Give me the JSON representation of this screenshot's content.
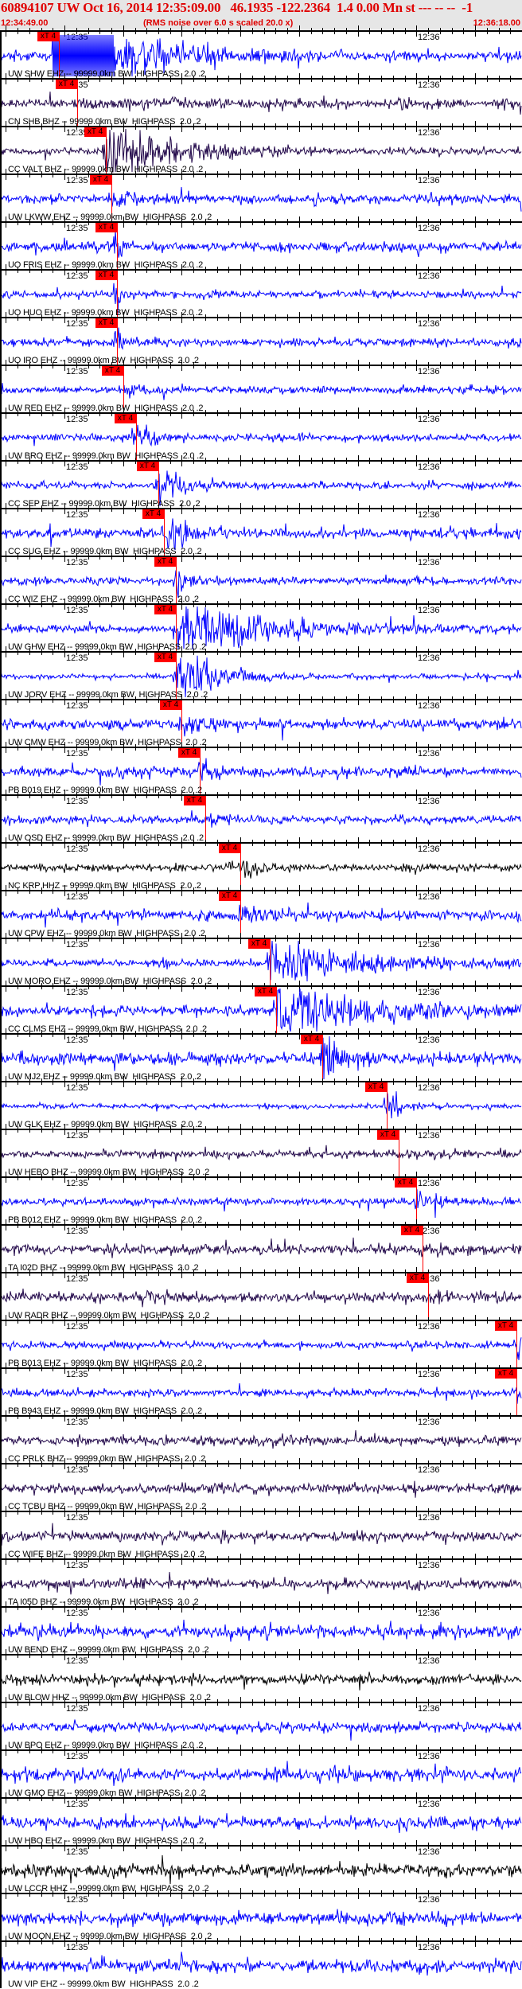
{
  "header": {
    "title": "60894107 UW Oct 16, 2014 12:35:09.00   46.1935 -122.2364  1.4 0.00 Mn st --- -- --  -1",
    "start_time": "12:34:49.00",
    "subtitle": "(RMS noise over 6.0 s scaled 20.0 x)",
    "end_time": "12:36:18.00"
  },
  "axis": {
    "tick_label_1": "12:35",
    "tick_label_2": "12:36",
    "window_seconds": 89,
    "tick_1_seconds": 11,
    "tick_2_seconds": 71
  },
  "pick_label": "xT 4",
  "colors": {
    "EHZ": "#0000ff",
    "BHZ": "#22084a",
    "HHZ": "#000000",
    "pick": "#ff0000",
    "title": "#e00000"
  },
  "stations": [
    {
      "label": "UW SHW EHZ -- 99999.0km BW  HIGHPASS  2.0 .2",
      "ch": "EHZ",
      "pick": 10.0,
      "noise": 4,
      "event": 40,
      "decay": 12,
      "clip": true
    },
    {
      "label": "CN SHB BHZ -- 99999.0km BW  HIGHPASS  2.0 .2",
      "ch": "BHZ",
      "pick": 13.2,
      "noise": 4,
      "event": 2,
      "decay": 10
    },
    {
      "label": "CC VALT BHZ -- 99999.0km BW  HIGHPASS  2.0 .2",
      "ch": "BHZ",
      "pick": 18.0,
      "noise": 3,
      "event": 30,
      "decay": 9
    },
    {
      "label": "UW LKWW EHZ -- 99999.0km BW  HIGHPASS  2.0 .2",
      "ch": "EHZ",
      "pick": 19.0,
      "noise": 4,
      "event": 8,
      "decay": 4
    },
    {
      "label": "UO FRIS EHZ -- 99999.0km BW  HIGHPASS  2.0 .2",
      "ch": "EHZ",
      "pick": 19.9,
      "noise": 4,
      "event": 30,
      "decay": 0.5
    },
    {
      "label": "UO HUO EHZ -- 99999.0km BW  HIGHPASS  2.0 .2",
      "ch": "EHZ",
      "pick": 19.9,
      "noise": 3,
      "event": 30,
      "decay": 0.5
    },
    {
      "label": "UO IRO EHZ -- 99999.0km BW  HIGHPASS  2.0 .2",
      "ch": "EHZ",
      "pick": 19.9,
      "noise": 3,
      "event": 28,
      "decay": 0.5
    },
    {
      "label": "UW RED EHZ -- 99999.0km BW  HIGHPASS  2.0 .2",
      "ch": "EHZ",
      "pick": 21.0,
      "noise": 3,
      "event": 6,
      "decay": 3
    },
    {
      "label": "UW BRO EHZ -- 99999.0km BW  HIGHPASS  2.0 .2",
      "ch": "EHZ",
      "pick": 23.2,
      "noise": 3,
      "event": 15,
      "decay": 2
    },
    {
      "label": "CC SEP EHZ -- 99999.0km BW  HIGHPASS  2.0 .2",
      "ch": "EHZ",
      "pick": 27.0,
      "noise": 3,
      "event": 18,
      "decay": 4
    },
    {
      "label": "CC SUG EHZ -- 99999.0km BW  HIGHPASS  2.0 .2",
      "ch": "EHZ",
      "pick": 28.0,
      "noise": 4,
      "event": 15,
      "decay": 4
    },
    {
      "label": "CC WIZ EHZ -- 99999.0km BW  HIGHPASS  2.0 .2",
      "ch": "EHZ",
      "pick": 30.0,
      "noise": 3,
      "event": 10,
      "decay": 2
    },
    {
      "label": "UW GHW EHZ -- 99999.0km BW  HIGHPASS  2.0 .2",
      "ch": "EHZ",
      "pick": 30.0,
      "noise": 3,
      "event": 25,
      "decay": 14
    },
    {
      "label": "UW JORV EHZ -- 99999.0km BW  HIGHPASS  2.0 .2",
      "ch": "EHZ",
      "pick": 30.0,
      "noise": 2,
      "event": 28,
      "decay": 6
    },
    {
      "label": "UW CMW EHZ -- 99999.0km BW  HIGHPASS  2.0 .2",
      "ch": "EHZ",
      "pick": 30.9,
      "noise": 4,
      "event": 6,
      "decay": 3
    },
    {
      "label": "PB B019 EHZ -- 99999.0km BW  HIGHPASS  2.0 .2",
      "ch": "EHZ",
      "pick": 34.1,
      "noise": 4,
      "event": 15,
      "decay": 2
    },
    {
      "label": "UW OSD EHZ -- 99999.0km BW  HIGHPASS  2.0 .2",
      "ch": "EHZ",
      "pick": 35.0,
      "noise": 3,
      "event": 6,
      "decay": 3
    },
    {
      "label": "NC KRP HHZ -- 99999.0km BW  HIGHPASS  2.0 .2",
      "ch": "HHZ",
      "pick": 41.0,
      "noise": 3,
      "event": 6,
      "decay": 4
    },
    {
      "label": "UW CPW EHZ -- 99999.0km BW  HIGHPASS  2.0 .2",
      "ch": "EHZ",
      "pick": 41.0,
      "noise": 4,
      "event": 10,
      "decay": 4
    },
    {
      "label": "UW MORO EHZ -- 99999.0km BW  HIGHPASS  2.0 .2",
      "ch": "EHZ",
      "pick": 46.0,
      "noise": 3,
      "event": 25,
      "decay": 12
    },
    {
      "label": "CC CLMS EHZ -- 99999.0km BW  HIGHPASS  2.0 .2",
      "ch": "EHZ",
      "pick": 47.1,
      "noise": 4,
      "event": 22,
      "decay": 14
    },
    {
      "label": "UW MJ2 EHZ -- 99999.0km BW  HIGHPASS  2.0 .2",
      "ch": "EHZ",
      "pick": 55.0,
      "noise": 5,
      "event": 15,
      "decay": 4
    },
    {
      "label": "UW GLK EHZ -- 99999.0km BW  HIGHPASS  2.0 .2",
      "ch": "EHZ",
      "pick": 65.9,
      "noise": 2,
      "event": 18,
      "decay": 2
    },
    {
      "label": "UW HEBO BHZ -- 99999.0km BW  HIGHPASS  2.0 .2",
      "ch": "BHZ",
      "pick": 68.0,
      "noise": 3,
      "event": 3,
      "decay": 3
    },
    {
      "label": "PB B012 EHZ -- 99999.0km BW  HIGHPASS  2.0 .2",
      "ch": "EHZ",
      "pick": 71.0,
      "noise": 3,
      "event": 8,
      "decay": 3
    },
    {
      "label": "TA I02D BHZ -- 99999.0km BW  HIGHPASS  2.0 .2",
      "ch": "BHZ",
      "pick": 72.0,
      "noise": 4,
      "event": 3,
      "decay": 3
    },
    {
      "label": "UW RADR BHZ -- 99999.0km BW  HIGHPASS  2.0 .2",
      "ch": "BHZ",
      "pick": 73.0,
      "noise": 4,
      "event": 3,
      "decay": 3
    },
    {
      "label": "PB B013 EHZ -- 99999.0km BW  HIGHPASS  2.0 .2",
      "ch": "EHZ",
      "pick": 88.1,
      "noise": 3,
      "event": 12,
      "decay": 1
    },
    {
      "label": "PB B943 EHZ -- 99999.0km BW  HIGHPASS  2.0 .2",
      "ch": "EHZ",
      "pick": 88.1,
      "noise": 3,
      "event": 10,
      "decay": 1
    },
    {
      "label": "CC PRLK BHZ -- 99999.0km BW  HIGHPASS  2.0 .2",
      "ch": "BHZ",
      "noise": 4
    },
    {
      "label": "CC TCBU BHZ -- 99999.0km BW  HIGHPASS  2.0 .2",
      "ch": "BHZ",
      "noise": 4
    },
    {
      "label": "CC WIFE BHZ -- 99999.0km BW  HIGHPASS  2.0 .2",
      "ch": "BHZ",
      "noise": 4
    },
    {
      "label": "TA I05D BHZ -- 99999.0km BW  HIGHPASS  2.0 .2",
      "ch": "BHZ",
      "noise": 4
    },
    {
      "label": "UW BEND EHZ -- 99999.0km BW  HIGHPASS  2.0 .2",
      "ch": "EHZ",
      "noise": 5
    },
    {
      "label": "UW BLOW HHZ -- 99999.0km BW  HIGHPASS  2.0 .2",
      "ch": "HHZ",
      "noise": 4
    },
    {
      "label": "UW BPO EHZ -- 99999.0km BW  HIGHPASS  2.0 .2",
      "ch": "EHZ",
      "noise": 4
    },
    {
      "label": "UW GMO EHZ -- 99999.0km BW  HIGHPASS  2.0 .2",
      "ch": "EHZ",
      "noise": 5
    },
    {
      "label": "UW HBO EHZ -- 99999.0km BW  HIGHPASS  2.0 .2",
      "ch": "EHZ",
      "noise": 5
    },
    {
      "label": "UW LCCR HHZ -- 99999.0km BW  HIGHPASS  2.0 .2",
      "ch": "HHZ",
      "noise": 5
    },
    {
      "label": "UW MOON EHZ -- 99999.0km BW  HIGHPASS  2.0 .2",
      "ch": "EHZ",
      "noise": 5
    },
    {
      "label": "UW VIP EHZ -- 99999.0km BW  HIGHPASS  2.0 .2",
      "ch": "EHZ",
      "noise": 5
    }
  ]
}
